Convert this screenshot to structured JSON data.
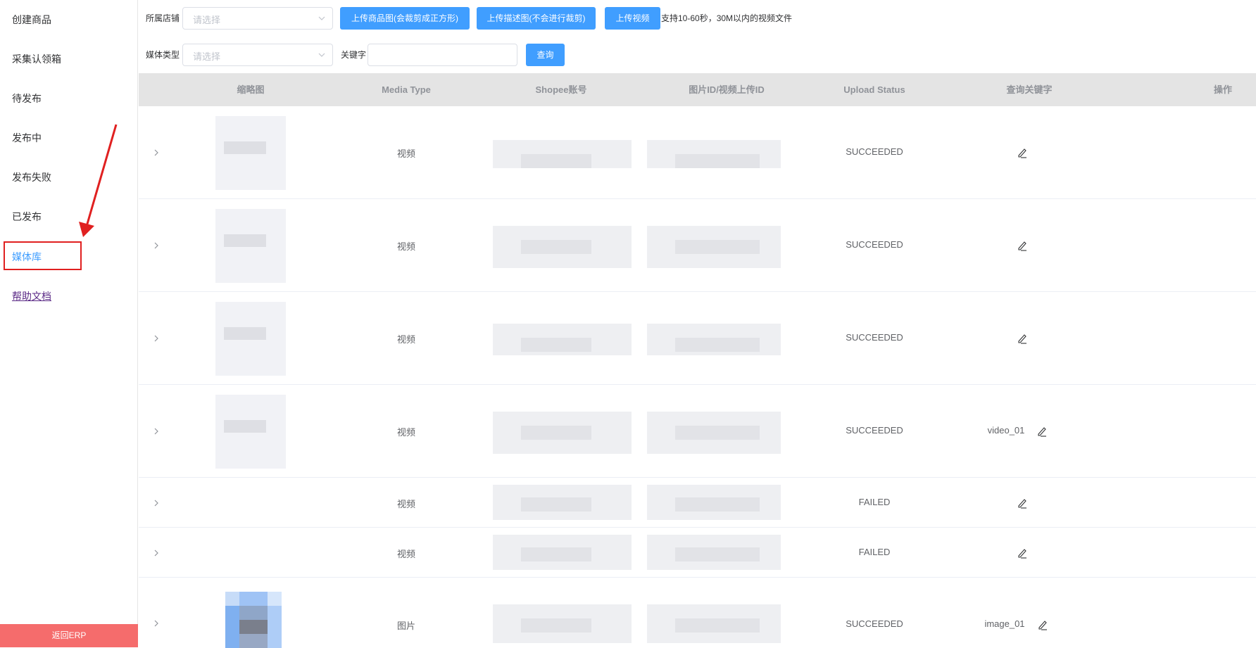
{
  "sidebar": {
    "items": [
      {
        "label": "创建商品"
      },
      {
        "label": "采集认领箱"
      },
      {
        "label": "待发布"
      },
      {
        "label": "发布中"
      },
      {
        "label": "发布失败"
      },
      {
        "label": "已发布"
      },
      {
        "label": "媒体库"
      },
      {
        "label": "帮助文档"
      }
    ],
    "active_item": "媒体库",
    "back_label": "返回ERP"
  },
  "filters": {
    "shop_label": "所属店铺",
    "shop_placeholder": "请选择",
    "upload_product_image": "上传商品图(会裁剪成正方形)",
    "upload_desc_image": "上传描述图(不会进行裁剪)",
    "upload_video": "上传视频",
    "video_hint": "支持10-60秒，30M以内的视频文件",
    "media_type_label": "媒体类型",
    "media_type_placeholder": "请选择",
    "keyword_label": "关键字",
    "keyword_value": "",
    "search_button": "查询"
  },
  "table": {
    "columns": [
      "缩略图",
      "Media Type",
      "Shopee账号",
      "图片ID/视频上传ID",
      "Upload Status",
      "查询关键字",
      "操作"
    ],
    "rows": [
      {
        "media_type": "视频",
        "status": "SUCCEEDED",
        "keyword": ""
      },
      {
        "media_type": "视频",
        "status": "SUCCEEDED",
        "keyword": ""
      },
      {
        "media_type": "视频",
        "status": "SUCCEEDED",
        "keyword": ""
      },
      {
        "media_type": "视频",
        "status": "SUCCEEDED",
        "keyword": "video_01"
      },
      {
        "media_type": "视频",
        "status": "FAILED",
        "keyword": ""
      },
      {
        "media_type": "视频",
        "status": "FAILED",
        "keyword": ""
      },
      {
        "media_type": "图片",
        "status": "SUCCEEDED",
        "keyword": "image_01"
      }
    ]
  },
  "icons": {
    "expand": "chevron-right-icon",
    "edit": "pencil-icon",
    "select": "chevron-down-icon"
  },
  "colors": {
    "primary": "#409eff",
    "danger": "#f56c6c",
    "annotation": "#e02020"
  }
}
